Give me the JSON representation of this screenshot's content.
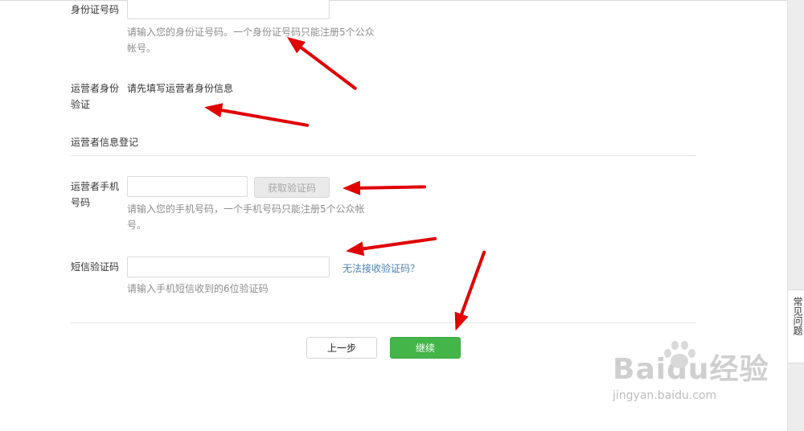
{
  "form": {
    "id_number": {
      "label": "身份证号码",
      "value": "",
      "hint": "请输入您的身份证号码。一个身份证号码只能注册5个公众帐号。"
    },
    "operator_verify": {
      "label": "运营者身份验证",
      "text": "请先填写运营者身份信息"
    },
    "operator_info_section": "运营者信息登记",
    "phone": {
      "label": "运营者手机号码",
      "value": "",
      "get_code_button": "获取验证码",
      "hint": "请输入您的手机号码，一个手机号码只能注册5个公众帐号。"
    },
    "sms_code": {
      "label": "短信验证码",
      "value": "",
      "help_link": "无法接收验证码？",
      "hint": "请输入手机短信收到的6位验证码"
    }
  },
  "actions": {
    "prev": "上一步",
    "next": "继续"
  },
  "sidebar": {
    "faq": "常见问题"
  },
  "watermark": {
    "brand": "Baidu经验",
    "url": "jingyan.baidu.com"
  },
  "colors": {
    "primary_button": "#44b549",
    "link": "#4a7fb3",
    "annotation_arrow": "#e00000"
  }
}
